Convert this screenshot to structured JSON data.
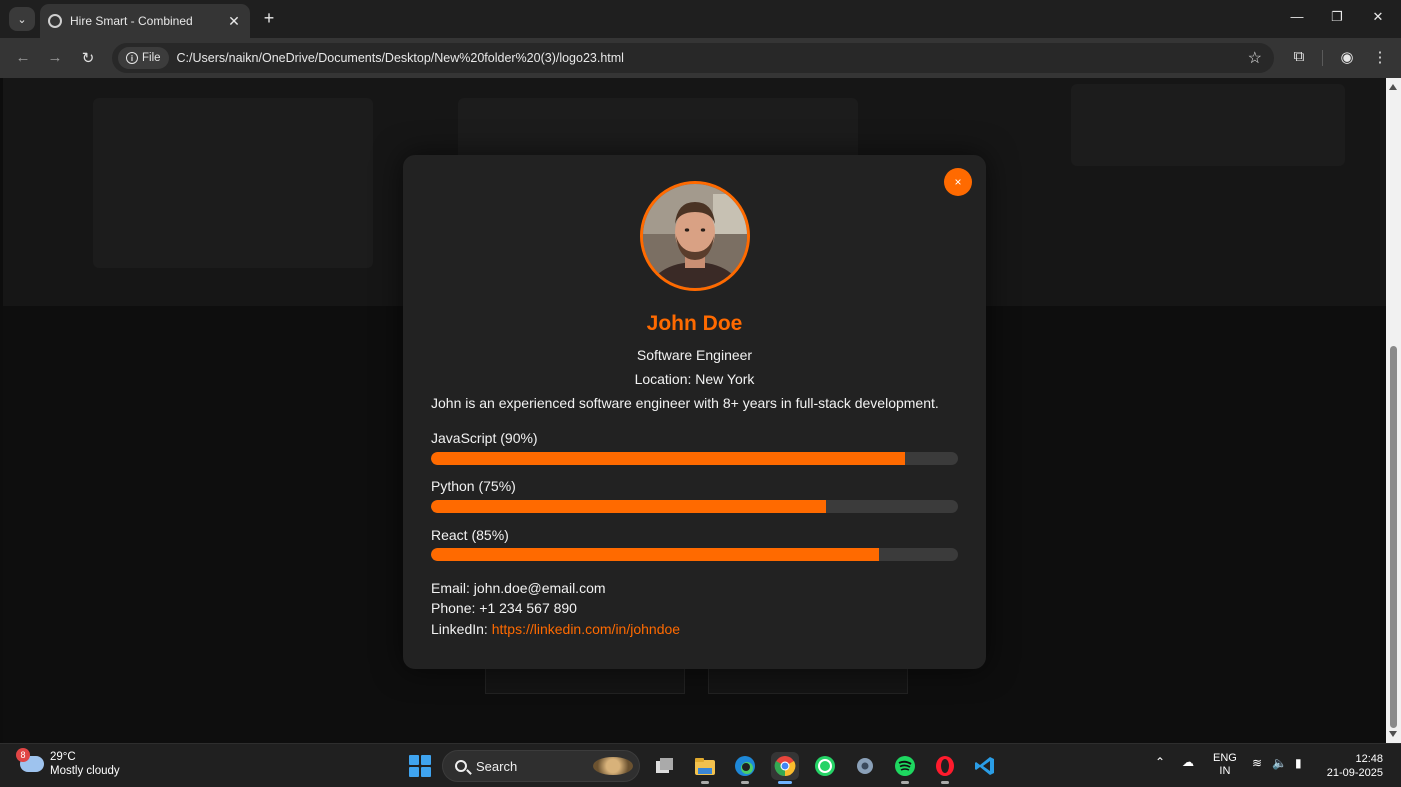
{
  "browser": {
    "tab_title": "Hire Smart - Combined",
    "file_chip": "File",
    "url": "C:/Users/naikn/OneDrive/Documents/Desktop/New%20folder%20(3)/logo23.html",
    "new_tab": "+",
    "tab_close": "✕"
  },
  "profile": {
    "close_symbol": "×",
    "name": "John Doe",
    "role": "Software Engineer",
    "location_label": "Location:",
    "location": "New York",
    "bio": "John is an experienced software engineer with 8+ years in full-stack development.",
    "skills": [
      {
        "label": "JavaScript (90%)",
        "percent": 90
      },
      {
        "label": "Python (75%)",
        "percent": 75
      },
      {
        "label": "React (85%)",
        "percent": 85
      }
    ],
    "email_label": "Email:",
    "email": "john.doe@email.com",
    "phone_label": "Phone:",
    "phone": "+1 234 567 890",
    "linkedin_label": "LinkedIn:",
    "linkedin": "https://linkedin.com/in/johndoe"
  },
  "colors": {
    "accent": "#ff6a00",
    "modal_bg": "#222222",
    "page_bg": "#0e0e0e"
  },
  "taskbar": {
    "weather_badge": "8",
    "weather_temp": "29°C",
    "weather_desc": "Mostly cloudy",
    "search_label": "Search",
    "lang_top": "ENG",
    "lang_bottom": "IN",
    "time": "12:48",
    "date": "21-09-2025",
    "apps": [
      "task-view-icon",
      "file-explorer-icon",
      "edge-icon",
      "chrome-icon",
      "whatsapp-icon",
      "settings-icon",
      "spotify-icon",
      "opera-icon",
      "vscode-icon"
    ]
  }
}
